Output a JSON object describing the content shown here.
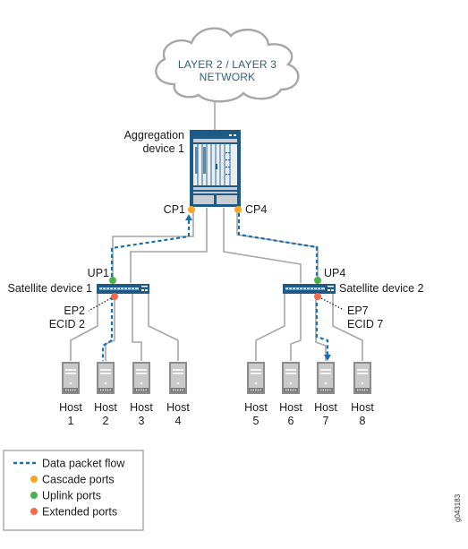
{
  "cloud": {
    "line1": "LAYER 2 / LAYER 3",
    "line2": "NETWORK"
  },
  "aggregation": {
    "label_line1": "Aggregation",
    "label_line2": "device 1",
    "ports": [
      {
        "name": "CP1",
        "type": "cascade"
      },
      {
        "name": "CP4",
        "type": "cascade"
      }
    ]
  },
  "satellites": [
    {
      "label": "Satellite device 1",
      "uplink": "UP1",
      "extended": "EP2",
      "ecid": "ECID 2"
    },
    {
      "label": "Satellite device 2",
      "uplink": "UP4",
      "extended": "EP7",
      "ecid": "ECID 7"
    }
  ],
  "hosts": [
    {
      "word": "Host",
      "num": "1"
    },
    {
      "word": "Host",
      "num": "2"
    },
    {
      "word": "Host",
      "num": "3"
    },
    {
      "word": "Host",
      "num": "4"
    },
    {
      "word": "Host",
      "num": "5"
    },
    {
      "word": "Host",
      "num": "6"
    },
    {
      "word": "Host",
      "num": "7"
    },
    {
      "word": "Host",
      "num": "8"
    }
  ],
  "legend": {
    "items": [
      {
        "label": "Data packet flow",
        "kind": "dashed",
        "color": "#1a6fae"
      },
      {
        "label": "Cascade ports",
        "kind": "dot",
        "color": "#f5a623"
      },
      {
        "label": "Uplink ports",
        "kind": "dot",
        "color": "#4caf50"
      },
      {
        "label": "Extended ports",
        "kind": "dot",
        "color": "#f26b4f"
      }
    ]
  },
  "colors": {
    "device_blue": "#1e5a86",
    "cascade": "#f5a623",
    "uplink": "#4caf50",
    "extended": "#f26b4f",
    "flow": "#1a6fae",
    "link": "#a6a6a6"
  },
  "figure_id": "g043183"
}
